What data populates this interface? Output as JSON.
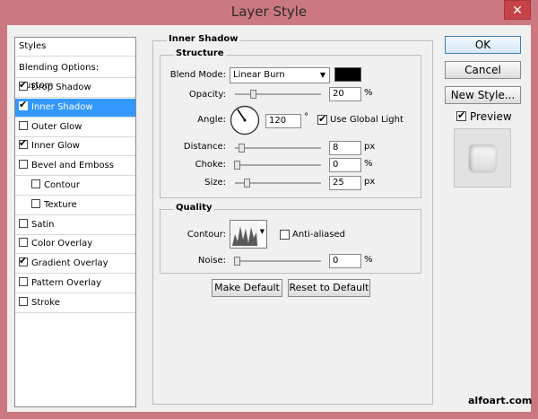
{
  "window": {
    "title": "Layer Style",
    "close_glyph": "✕"
  },
  "styles_list": {
    "header": "Styles",
    "blending": "Blending Options: Custom",
    "items": [
      {
        "label": "Drop Shadow",
        "checked": true,
        "selected": false,
        "indent": false
      },
      {
        "label": "Inner Shadow",
        "checked": true,
        "selected": true,
        "indent": false
      },
      {
        "label": "Outer Glow",
        "checked": false,
        "selected": false,
        "indent": false
      },
      {
        "label": "Inner Glow",
        "checked": true,
        "selected": false,
        "indent": false
      },
      {
        "label": "Bevel and Emboss",
        "checked": false,
        "selected": false,
        "indent": false
      },
      {
        "label": "Contour",
        "checked": false,
        "selected": false,
        "indent": true
      },
      {
        "label": "Texture",
        "checked": false,
        "selected": false,
        "indent": true
      },
      {
        "label": "Satin",
        "checked": false,
        "selected": false,
        "indent": false
      },
      {
        "label": "Color Overlay",
        "checked": false,
        "selected": false,
        "indent": false
      },
      {
        "label": "Gradient Overlay",
        "checked": true,
        "selected": false,
        "indent": false
      },
      {
        "label": "Pattern Overlay",
        "checked": false,
        "selected": false,
        "indent": false
      },
      {
        "label": "Stroke",
        "checked": false,
        "selected": false,
        "indent": false
      }
    ]
  },
  "inner_shadow": {
    "group_title": "Inner Shadow",
    "structure": {
      "title": "Structure",
      "blend_mode_label": "Blend Mode:",
      "blend_mode_value": "Linear Burn",
      "color": "#000000",
      "opacity_label": "Opacity:",
      "opacity_value": "20",
      "opacity_unit": "%",
      "angle_label": "Angle:",
      "angle_value": "120",
      "angle_unit": "°",
      "use_global_light_label": "Use Global Light",
      "use_global_light": true,
      "distance_label": "Distance:",
      "distance_value": "8",
      "distance_unit": "px",
      "choke_label": "Choke:",
      "choke_value": "0",
      "choke_unit": "%",
      "size_label": "Size:",
      "size_value": "25",
      "size_unit": "px"
    },
    "quality": {
      "title": "Quality",
      "contour_label": "Contour:",
      "anti_aliased_label": "Anti-aliased",
      "anti_aliased": false,
      "noise_label": "Noise:",
      "noise_value": "0",
      "noise_unit": "%"
    },
    "make_default": "Make Default",
    "reset_default": "Reset to Default"
  },
  "actions": {
    "ok": "OK",
    "cancel": "Cancel",
    "new_style": "New Style...",
    "preview_label": "Preview",
    "preview_checked": true
  },
  "watermark": "alfoart.com"
}
